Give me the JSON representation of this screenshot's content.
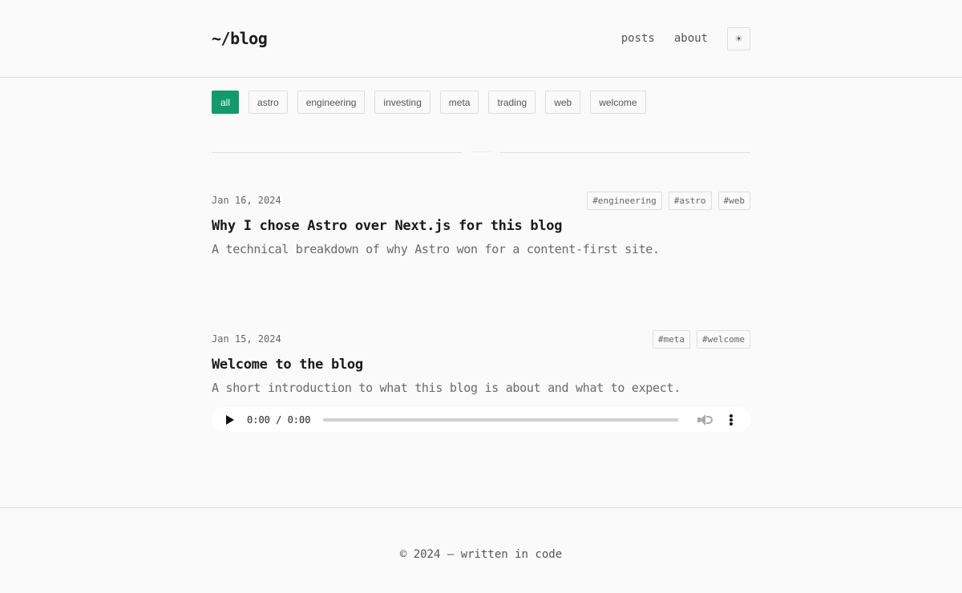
{
  "header": {
    "site_title": "~/blog",
    "nav": [
      {
        "label": "posts"
      },
      {
        "label": "about"
      }
    ],
    "theme_toggle_icon": "sun-icon",
    "theme_toggle_glyph": "☀"
  },
  "filters": {
    "active": "all",
    "items": [
      {
        "label": "all"
      },
      {
        "label": "astro"
      },
      {
        "label": "engineering"
      },
      {
        "label": "investing"
      },
      {
        "label": "meta"
      },
      {
        "label": "trading"
      },
      {
        "label": "web"
      },
      {
        "label": "welcome"
      }
    ]
  },
  "posts": [
    {
      "date": "Jan 16, 2024",
      "title": "Why I chose Astro over Next.js for this blog",
      "description": "A technical breakdown of why Astro won for a content-first site.",
      "tags": [
        "#engineering",
        "#astro",
        "#web"
      ]
    },
    {
      "date": "Jan 15, 2024",
      "title": "Welcome to the blog",
      "description": "A short introduction to what this blog is about and what to expect.",
      "tags": [
        "#meta",
        "#welcome"
      ],
      "audio": {
        "time": "0:00 / 0:00",
        "progress": 0
      }
    }
  ],
  "footer": {
    "text": "© 2024 — written in code"
  },
  "colors": {
    "accent": "#0f9b6c",
    "border": "#dedede",
    "background": "#fafafa"
  }
}
